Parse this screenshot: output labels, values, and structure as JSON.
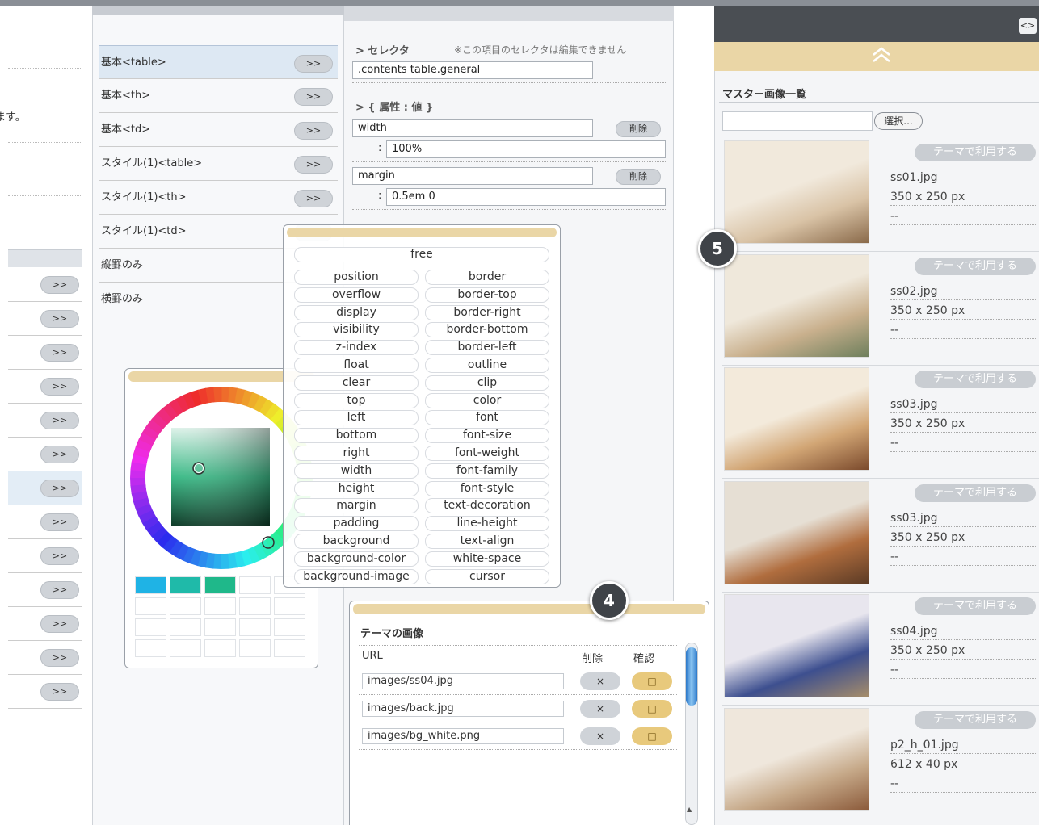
{
  "left_column": {
    "partial_text": "ます。",
    "pill_label": ">>"
  },
  "selector_list": {
    "items": [
      {
        "label": "基本<table>",
        "pill": ">>"
      },
      {
        "label": "基本<th>",
        "pill": ">>"
      },
      {
        "label": "基本<td>",
        "pill": ">>"
      },
      {
        "label": "スタイル(1)<table>",
        "pill": ">>"
      },
      {
        "label": "スタイル(1)<th>",
        "pill": ">>"
      },
      {
        "label": "スタイル(1)<td>",
        "pill": ">>"
      },
      {
        "label": "縦罫のみ",
        "pill": ""
      },
      {
        "label": "横罫のみ",
        "pill": ""
      }
    ]
  },
  "properties": {
    "selector_title": "> セレクタ",
    "selector_note": "※この項目のセレクタは編集できません",
    "selector_value": ".contents table.general",
    "attr_title": "> { 属性 : 値 }",
    "colon": ":",
    "delete_label": "削除",
    "rows": [
      {
        "name": "width",
        "value": "100%"
      },
      {
        "name": "margin",
        "value": "0.5em 0"
      }
    ]
  },
  "property_picker": {
    "free_label": "free",
    "left": [
      "position",
      "overflow",
      "display",
      "visibility",
      "z-index",
      "float",
      "clear",
      "top",
      "left",
      "bottom",
      "right",
      "width",
      "height",
      "margin",
      "padding",
      "background",
      "background-color",
      "background-image"
    ],
    "right": [
      "border",
      "border-top",
      "border-right",
      "border-bottom",
      "border-left",
      "outline",
      "clip",
      "color",
      "font",
      "font-size",
      "font-weight",
      "font-family",
      "font-style",
      "text-decoration",
      "line-height",
      "text-align",
      "white-space",
      "cursor"
    ]
  },
  "color_picker": {
    "swatches": [
      "#1fb3e5",
      "#1fbaa9",
      "#1fb88a"
    ]
  },
  "theme_images": {
    "title": "テーマの画像",
    "col_url": "URL",
    "col_delete": "削除",
    "col_confirm": "確認",
    "delete_glyph": "×",
    "confirm_glyph": "□",
    "rows": [
      "images/ss04.jpg",
      "images/back.jpg",
      "images/bg_white.png"
    ]
  },
  "master_images": {
    "toggle_label": "<>",
    "collapse_icon": "double-chevron-up-icon",
    "title": "マスター画像一覧",
    "select_button": "選択...",
    "use_button": "テーマで利用する",
    "dash": "--",
    "items": [
      {
        "file": "ss01.jpg",
        "size": "350 x 250 px"
      },
      {
        "file": "ss02.jpg",
        "size": "350 x 250 px"
      },
      {
        "file": "ss03.jpg",
        "size": "350 x 250 px"
      },
      {
        "file": "ss03.jpg",
        "size": "350 x 250 px"
      },
      {
        "file": "ss04.jpg",
        "size": "350 x 250 px"
      },
      {
        "file": "p2_h_01.jpg",
        "size": "612 x 40 px"
      }
    ]
  },
  "callouts": {
    "four": "4",
    "five": "5"
  },
  "colors": {
    "accent_gold": "#ead6a6",
    "dark_header": "#4a4e53",
    "selected_row": "#dde8f3"
  }
}
